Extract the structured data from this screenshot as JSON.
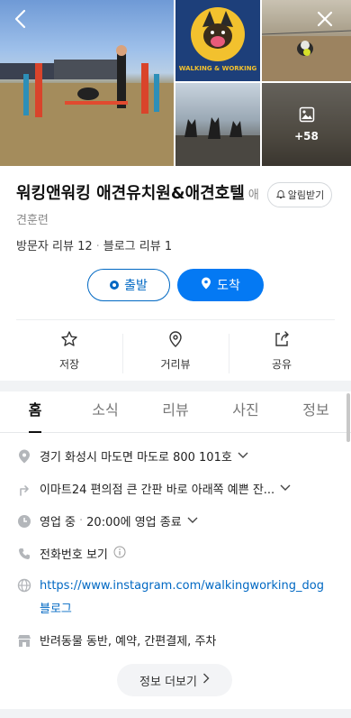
{
  "header": {
    "back_icon": "chevron-left-icon",
    "close_icon": "close-icon",
    "logo_text": "WALKING & WORKING",
    "more_photos_count": "+58"
  },
  "place": {
    "name": "워킹앤워킹 애견유치원&애견호텔",
    "category": "애견훈련",
    "alarm_label": "알림받기",
    "visitor_reviews": "방문자 리뷰 12",
    "blog_reviews": "블로그 리뷰 1"
  },
  "route": {
    "start_label": "출발",
    "arrive_label": "도착"
  },
  "actions": [
    {
      "label": "저장",
      "icon": "star-icon"
    },
    {
      "label": "거리뷰",
      "icon": "location-pin-icon"
    },
    {
      "label": "공유",
      "icon": "share-icon"
    }
  ],
  "tabs": [
    "홈",
    "소식",
    "리뷰",
    "사진",
    "정보"
  ],
  "details": {
    "address": "경기 화성시 마도면 마도로 800 101호",
    "directions": "이마트24 편의점 큰 간판 바로 아래쪽 예쁜 잔...",
    "status": "영업 중",
    "hours": "20:00에 영업 종료",
    "phone": "전화번호 보기",
    "website": "https://www.instagram.com/walkingworking_dog",
    "blog": "블로그",
    "amenities": "반려동물 동반, 예약, 간편결제, 주차",
    "more_label": "정보 더보기"
  },
  "colors": {
    "accent": "#0479f3",
    "link": "#0068c3",
    "logo_bg": "#1d3f7a",
    "logo_yellow": "#f2c12e"
  }
}
